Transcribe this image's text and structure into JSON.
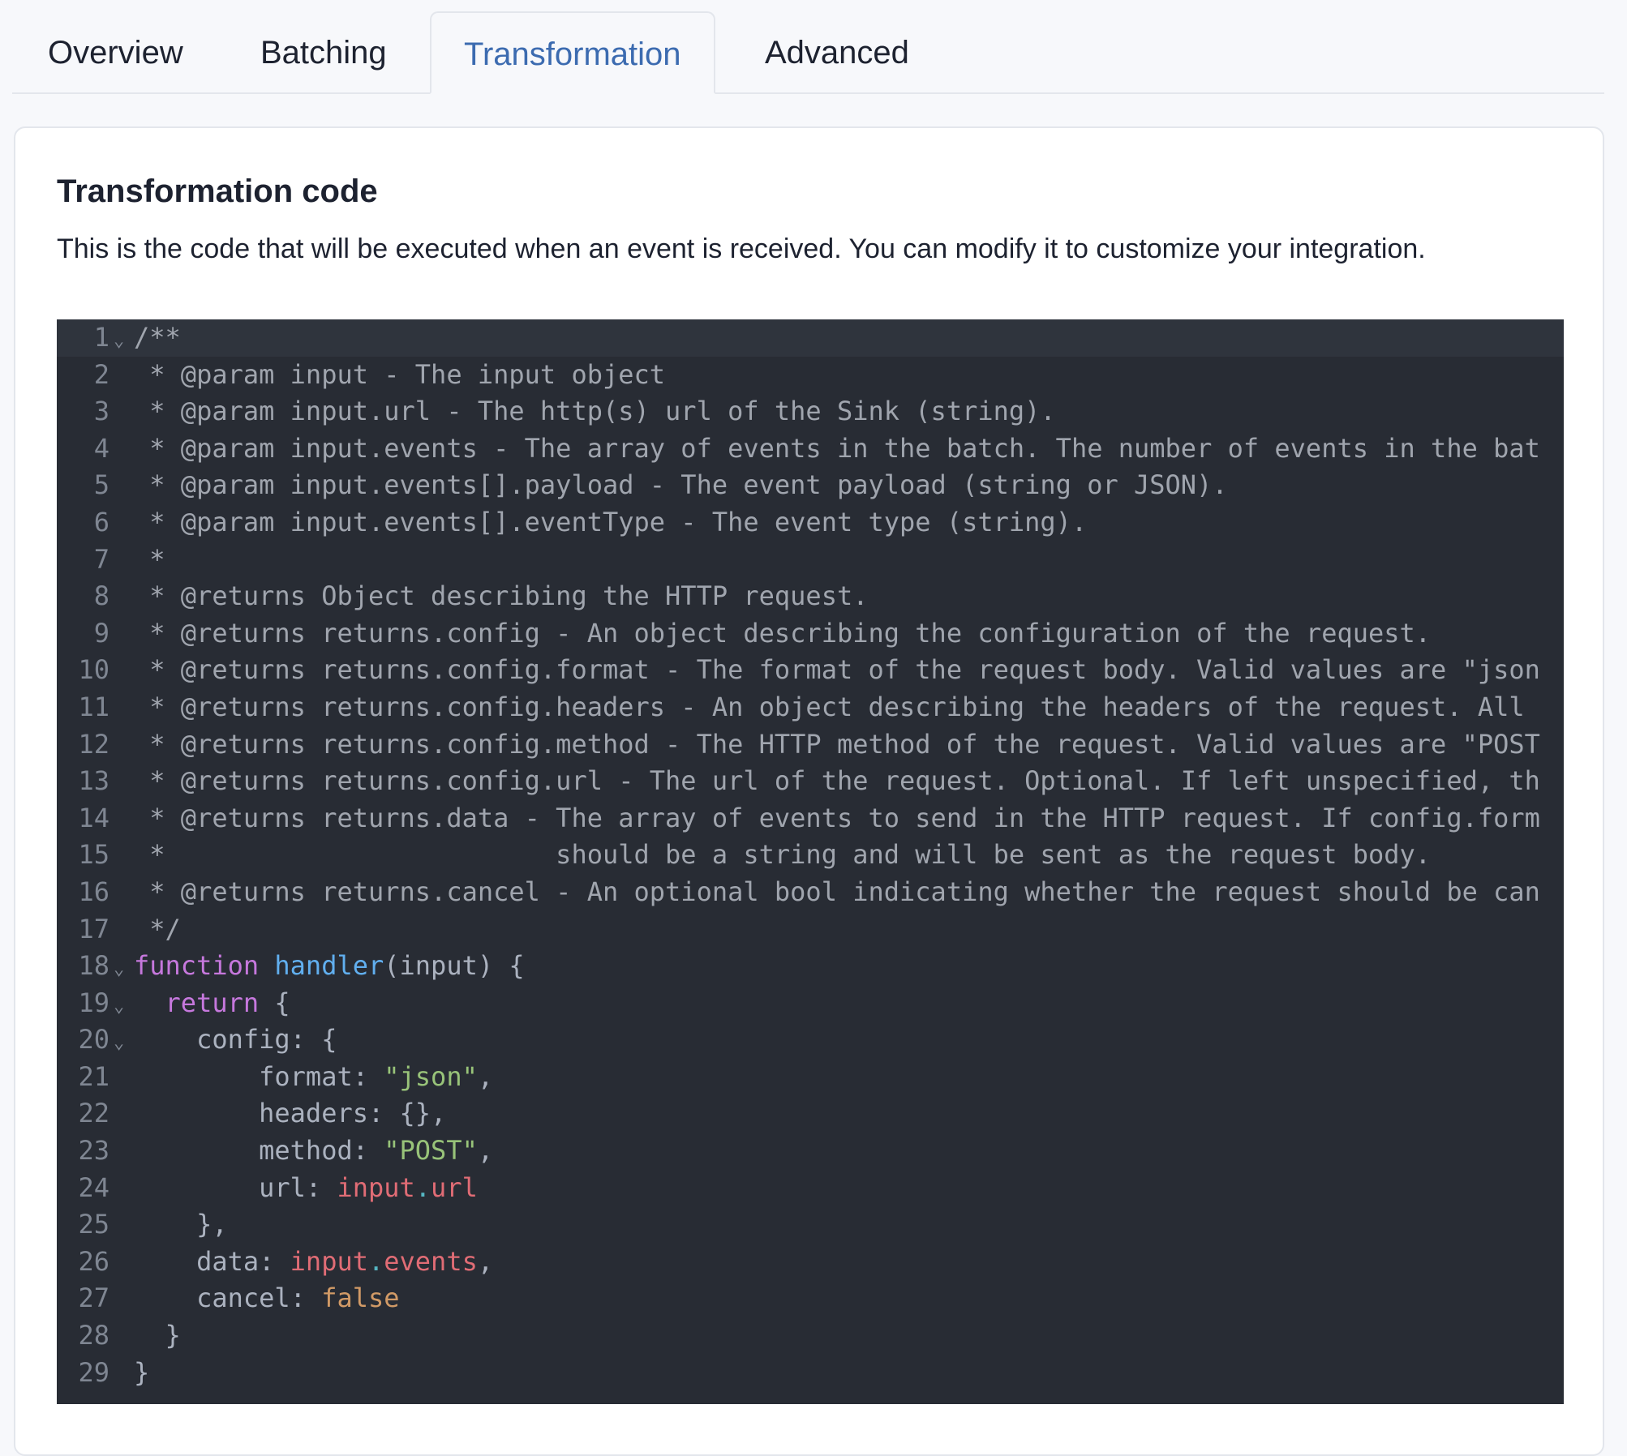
{
  "tabs": [
    {
      "label": "Overview",
      "active": false
    },
    {
      "label": "Batching",
      "active": false
    },
    {
      "label": "Transformation",
      "active": true
    },
    {
      "label": "Advanced",
      "active": false
    }
  ],
  "section": {
    "title": "Transformation code",
    "description": "This is the code that will be executed when an event is received. You can modify it to customize your integration."
  },
  "colors": {
    "accent": "#3c6bb0",
    "editor_bg": "#282c34",
    "keyword": "#c678dd",
    "function": "#61afef",
    "string": "#98c379",
    "variable": "#e06c75",
    "boolean": "#d19a66"
  },
  "editor": {
    "lines": [
      {
        "n": "1",
        "fold": true,
        "tokens": [
          [
            "/**",
            "comment"
          ]
        ]
      },
      {
        "n": "2",
        "tokens": [
          [
            " * @param input - The input object",
            "comment"
          ]
        ]
      },
      {
        "n": "3",
        "tokens": [
          [
            " * @param input.url - The http(s) url of the Sink (string).",
            "comment"
          ]
        ]
      },
      {
        "n": "4",
        "tokens": [
          [
            " * @param input.events - The array of events in the batch. The number of events in the bat",
            "comment"
          ]
        ]
      },
      {
        "n": "5",
        "tokens": [
          [
            " * @param input.events[].payload - The event payload (string or JSON).",
            "comment"
          ]
        ]
      },
      {
        "n": "6",
        "tokens": [
          [
            " * @param input.events[].eventType - The event type (string).",
            "comment"
          ]
        ]
      },
      {
        "n": "7",
        "tokens": [
          [
            " *",
            "comment"
          ]
        ]
      },
      {
        "n": "8",
        "tokens": [
          [
            " * @returns Object describing the HTTP request.",
            "comment"
          ]
        ]
      },
      {
        "n": "9",
        "tokens": [
          [
            " * @returns returns.config - An object describing the configuration of the request.",
            "comment"
          ]
        ]
      },
      {
        "n": "10",
        "tokens": [
          [
            " * @returns returns.config.format - The format of the request body. Valid values are \"json",
            "comment"
          ]
        ]
      },
      {
        "n": "11",
        "tokens": [
          [
            " * @returns returns.config.headers - An object describing the headers of the request. All",
            "comment"
          ]
        ]
      },
      {
        "n": "12",
        "tokens": [
          [
            " * @returns returns.config.method - The HTTP method of the request. Valid values are \"POST",
            "comment"
          ]
        ]
      },
      {
        "n": "13",
        "tokens": [
          [
            " * @returns returns.config.url - The url of the request. Optional. If left unspecified, th",
            "comment"
          ]
        ]
      },
      {
        "n": "14",
        "tokens": [
          [
            " * @returns returns.data - The array of events to send in the HTTP request. If config.form",
            "comment"
          ]
        ]
      },
      {
        "n": "15",
        "tokens": [
          [
            " *                         should be a string and will be sent as the request body.",
            "comment"
          ]
        ]
      },
      {
        "n": "16",
        "tokens": [
          [
            " * @returns returns.cancel - An optional bool indicating whether the request should be can",
            "comment"
          ]
        ]
      },
      {
        "n": "17",
        "tokens": [
          [
            " */",
            "comment"
          ]
        ]
      },
      {
        "n": "18",
        "fold": true,
        "tokens": [
          [
            "function",
            "kw"
          ],
          [
            " ",
            "plain"
          ],
          [
            "handler",
            "fn"
          ],
          [
            "(input) {",
            "plain"
          ]
        ]
      },
      {
        "n": "19",
        "fold": true,
        "tokens": [
          [
            "  ",
            "plain"
          ],
          [
            "return",
            "kw"
          ],
          [
            " {",
            "plain"
          ]
        ]
      },
      {
        "n": "20",
        "fold": true,
        "tokens": [
          [
            "    config: {",
            "plain"
          ]
        ]
      },
      {
        "n": "21",
        "tokens": [
          [
            "        format: ",
            "plain"
          ],
          [
            "\"json\"",
            "str"
          ],
          [
            ",",
            "plain"
          ]
        ]
      },
      {
        "n": "22",
        "tokens": [
          [
            "        headers: {},",
            "plain"
          ]
        ]
      },
      {
        "n": "23",
        "tokens": [
          [
            "        method: ",
            "plain"
          ],
          [
            "\"POST\"",
            "str"
          ],
          [
            ",",
            "plain"
          ]
        ]
      },
      {
        "n": "24",
        "tokens": [
          [
            "        url: ",
            "plain"
          ],
          [
            "input",
            "var"
          ],
          [
            ".",
            "dot"
          ],
          [
            "url",
            "var"
          ]
        ]
      },
      {
        "n": "25",
        "tokens": [
          [
            "    },",
            "plain"
          ]
        ]
      },
      {
        "n": "26",
        "tokens": [
          [
            "    data: ",
            "plain"
          ],
          [
            "input",
            "var"
          ],
          [
            ".",
            "dot"
          ],
          [
            "events",
            "var"
          ],
          [
            ",",
            "plain"
          ]
        ]
      },
      {
        "n": "27",
        "tokens": [
          [
            "    cancel: ",
            "plain"
          ],
          [
            "false",
            "bool"
          ]
        ]
      },
      {
        "n": "28",
        "tokens": [
          [
            "  }",
            "plain"
          ]
        ]
      },
      {
        "n": "29",
        "tokens": [
          [
            "}",
            "plain"
          ]
        ]
      }
    ]
  }
}
